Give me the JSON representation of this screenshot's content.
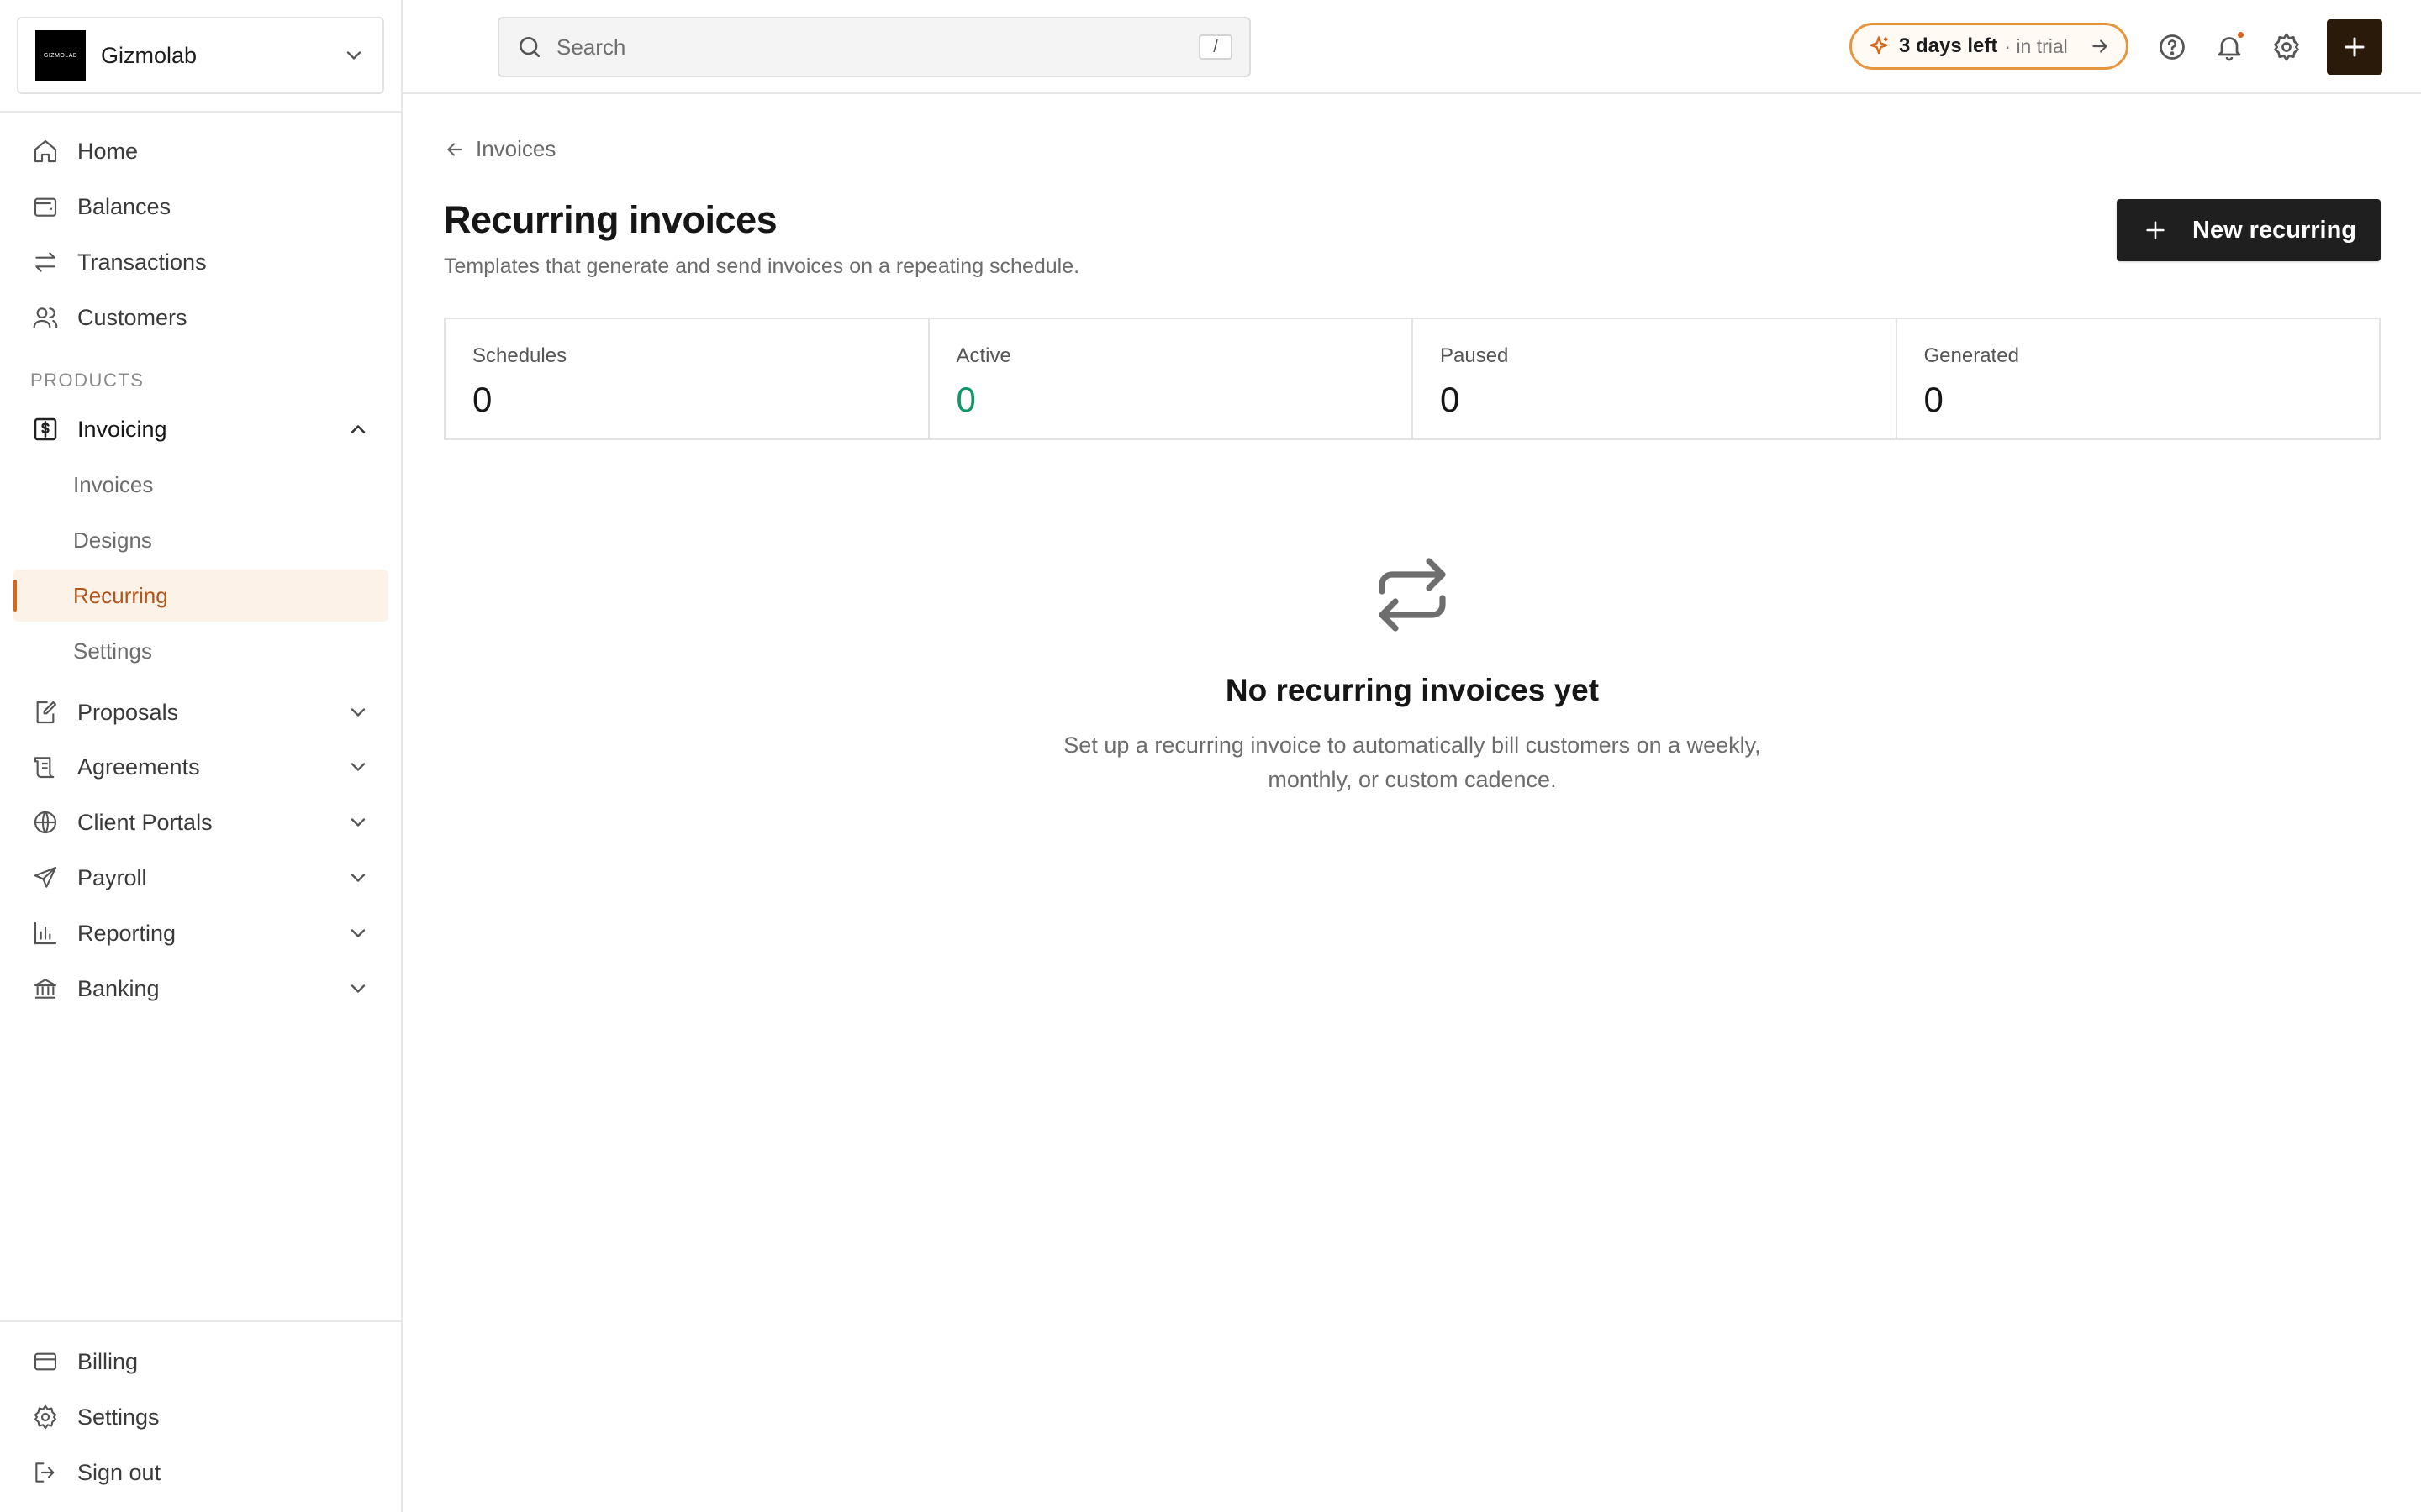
{
  "org": {
    "name": "Gizmolab",
    "logo_text": "GIZMOLAB"
  },
  "nav": {
    "home": "Home",
    "balances": "Balances",
    "transactions": "Transactions",
    "customers": "Customers",
    "section_products": "PRODUCTS",
    "invoicing": "Invoicing",
    "invoicing_sub": [
      "Invoices",
      "Designs",
      "Recurring",
      "Settings"
    ],
    "proposals": "Proposals",
    "agreements": "Agreements",
    "client_portals": "Client Portals",
    "payroll": "Payroll",
    "reporting": "Reporting",
    "banking": "Banking",
    "billing": "Billing",
    "settings": "Settings",
    "sign_out": "Sign out"
  },
  "topbar": {
    "search_placeholder": "Search",
    "search_shortcut": "/",
    "trial_bold": "3 days left",
    "trial_soft": "· in trial"
  },
  "page": {
    "back_label": "Invoices",
    "title": "Recurring invoices",
    "subtitle": "Templates that generate and send invoices on a repeating schedule.",
    "new_button": "New recurring"
  },
  "stats": [
    {
      "label": "Schedules",
      "value": "0"
    },
    {
      "label": "Active",
      "value": "0"
    },
    {
      "label": "Paused",
      "value": "0"
    },
    {
      "label": "Generated",
      "value": "0"
    }
  ],
  "empty_state": {
    "title": "No recurring invoices yet",
    "body": "Set up a recurring invoice to automatically bill customers on a weekly, monthly, or custom cadence."
  },
  "colors": {
    "accent": "#d2691e",
    "active_bg": "#fdf2e8",
    "active_value": "#129665",
    "primary_button": "#1f1f1f",
    "add_button": "#2a1a0a"
  }
}
